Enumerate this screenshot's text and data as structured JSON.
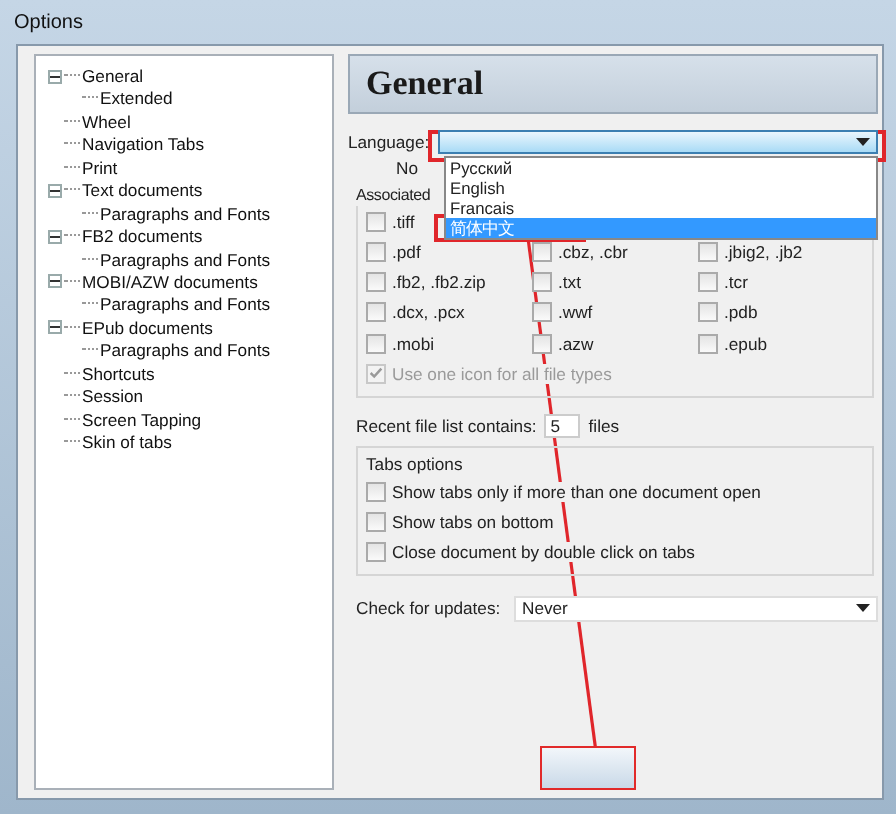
{
  "window": {
    "title": "Options"
  },
  "tree": [
    {
      "label": "General",
      "expanded": true,
      "children": [
        {
          "label": "Extended"
        }
      ]
    },
    {
      "label": "Wheel"
    },
    {
      "label": "Navigation Tabs"
    },
    {
      "label": "Print"
    },
    {
      "label": "Text documents",
      "expanded": true,
      "children": [
        {
          "label": "Paragraphs and Fonts"
        }
      ]
    },
    {
      "label": "FB2 documents",
      "expanded": true,
      "children": [
        {
          "label": "Paragraphs and Fonts"
        }
      ]
    },
    {
      "label": "MOBI/AZW documents",
      "expanded": true,
      "children": [
        {
          "label": "Paragraphs and Fonts"
        }
      ]
    },
    {
      "label": "EPub documents",
      "expanded": true,
      "children": [
        {
          "label": "Paragraphs and Fonts"
        }
      ]
    },
    {
      "label": "Shortcuts"
    },
    {
      "label": "Session"
    },
    {
      "label": "Screen Tapping"
    },
    {
      "label": "Skin of tabs"
    }
  ],
  "panel": {
    "title": "General",
    "language": {
      "label": "Language:",
      "options": [
        {
          "label": "Русский",
          "selected": false
        },
        {
          "label": "English",
          "selected": false
        },
        {
          "label": "Francais",
          "selected": false
        },
        {
          "label": "简体中文",
          "selected": true
        }
      ]
    },
    "covered_label": "No",
    "associated_label": "Associated",
    "file_type_columns": [
      [
        {
          "label": ".tiff",
          "checked": false
        },
        {
          "label": ".pdf",
          "checked": false
        },
        {
          "label": ".fb2, .fb2.zip",
          "checked": false
        },
        {
          "label": ".dcx, .pcx",
          "checked": false
        },
        {
          "label": ".mobi",
          "checked": false
        }
      ],
      [
        {
          "label": ".cbz, .cbr",
          "checked": false
        },
        {
          "label": ".txt",
          "checked": false
        },
        {
          "label": ".wwf",
          "checked": false
        },
        {
          "label": ".azw",
          "checked": false
        }
      ],
      [
        {
          "label": ".jbig2, .jb2",
          "checked": false
        },
        {
          "label": ".tcr",
          "checked": false
        },
        {
          "label": ".pdb",
          "checked": false
        },
        {
          "label": ".epub",
          "checked": false
        }
      ]
    ],
    "one_icon": {
      "label": "Use one icon for all file types",
      "checked": true,
      "disabled": true
    },
    "recent": {
      "label": "Recent file list contains:",
      "value": "5",
      "suffix": "files"
    },
    "tabs_options": {
      "title": "Tabs options",
      "items": [
        {
          "label": "Show tabs only if more than one document open",
          "checked": false
        },
        {
          "label": "Show tabs on bottom",
          "checked": false
        },
        {
          "label": "Close document by double click on tabs",
          "checked": false
        }
      ]
    },
    "updates": {
      "label": "Check for updates:",
      "value": "Never"
    }
  }
}
